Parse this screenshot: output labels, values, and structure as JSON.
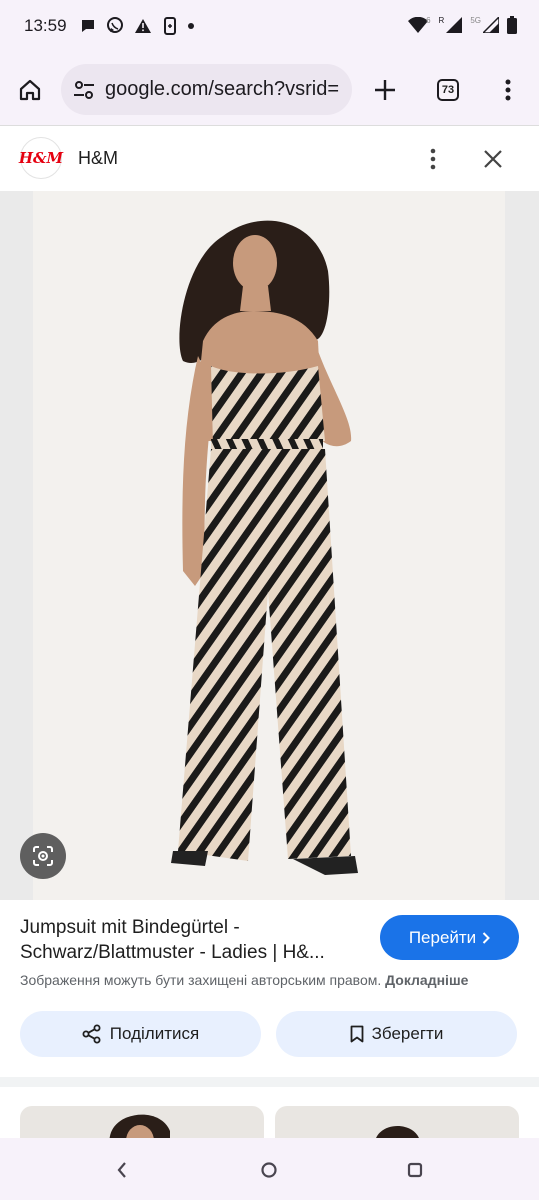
{
  "status_bar": {
    "time": "13:59",
    "network_label": "5G",
    "signal_r_label": "R",
    "wifi_sup": "6"
  },
  "browser": {
    "url": "google.com/search?vsrid=",
    "tab_count": "73"
  },
  "source": {
    "logo_text": "H&M",
    "name": "H&M"
  },
  "result": {
    "title": "Jumpsuit mit Bindegürtel - Schwarz/Blattmuster - Ladies | H&...",
    "visit_label": "Перейти",
    "copyright_text": "Зображення можуть бути захищені авторським правом.",
    "copyright_more": "Докладніше",
    "share_label": "Поділитися",
    "save_label": "Зберегти"
  },
  "colors": {
    "accent": "#1a73e8",
    "pill_bg": "#e8f0fe",
    "brand_red": "#e50010"
  },
  "icons": {
    "home": "home-icon",
    "site_settings": "tune-icon",
    "new_tab": "plus-icon",
    "menu": "more-vert-icon",
    "close": "close-icon",
    "lens": "lens-icon",
    "share": "share-icon",
    "bookmark": "bookmark-icon"
  }
}
